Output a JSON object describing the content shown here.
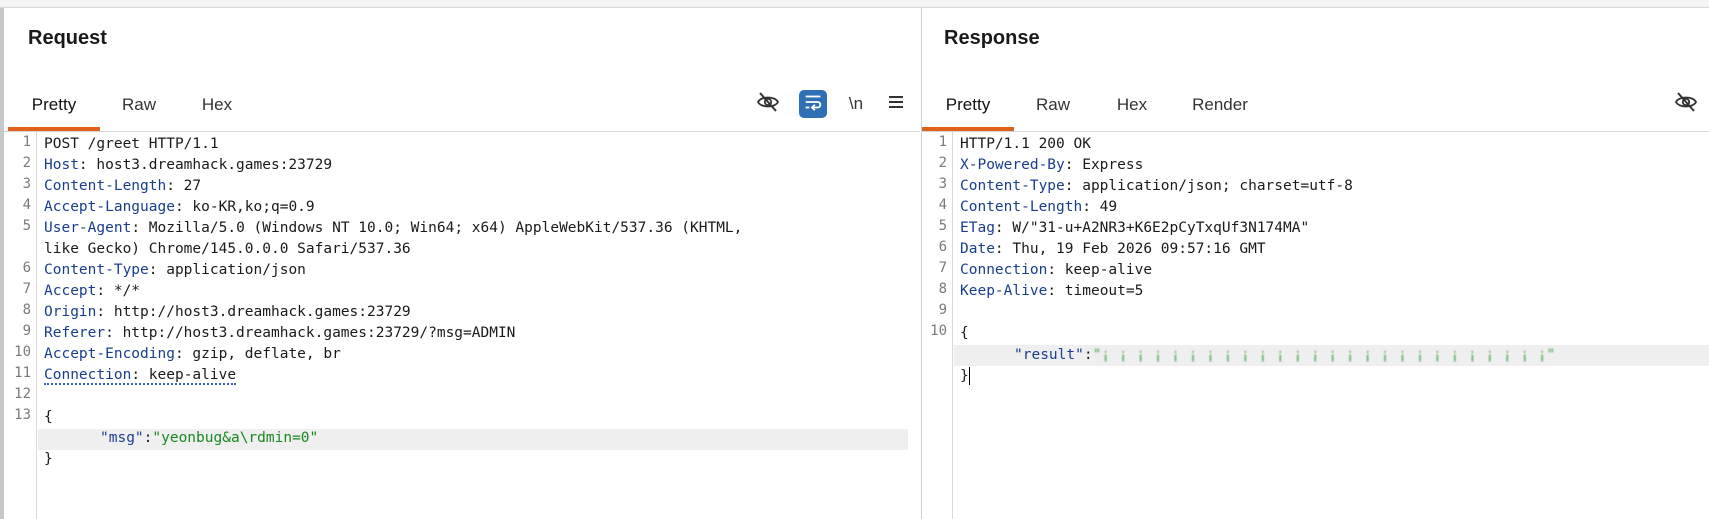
{
  "request": {
    "title": "Request",
    "tabs": [
      "Pretty",
      "Raw",
      "Hex"
    ],
    "tools": {
      "hide_icon": "eye-slash-icon",
      "wrap_icon": "wrap-icon",
      "newline_label": "\\n",
      "menu_icon": "hamburger-icon"
    },
    "line_numbers": [
      "1",
      "2",
      "3",
      "4",
      "5",
      "",
      "6",
      "7",
      "8",
      "9",
      "10",
      "11",
      "12",
      "13"
    ],
    "lines": [
      {
        "name": "",
        "value": "POST /greet HTTP/1.1"
      },
      {
        "name": "Host",
        "value": ": host3.dreamhack.games:23729"
      },
      {
        "name": "Content-Length",
        "value": ": 27"
      },
      {
        "name": "Accept-Language",
        "value": ": ko-KR,ko;q=0.9"
      },
      {
        "name": "User-Agent",
        "value": ": Mozilla/5.0 (Windows NT 10.0; Win64; x64) AppleWebKit/537.36 (KHTML,"
      },
      {
        "name": "",
        "value": "like Gecko) Chrome/145.0.0.0 Safari/537.36"
      },
      {
        "name": "Content-Type",
        "value": ": application/json"
      },
      {
        "name": "Accept",
        "value": ": */*"
      },
      {
        "name": "Origin",
        "value": ": http://host3.dreamhack.games:23729"
      },
      {
        "name": "Referer",
        "value": ": http://host3.dreamhack.games:23729/?msg=ADMIN"
      },
      {
        "name": "Accept-Encoding",
        "value": ": gzip, deflate, br"
      },
      {
        "name": "Connection",
        "value": ": keep-alive"
      },
      {
        "name": "",
        "value": ""
      },
      {
        "name": "",
        "value": "{"
      }
    ],
    "body": {
      "key": "\"msg\"",
      "colon": ":",
      "value": "\"yeonbug&a\\rdmin=0\"",
      "close": "}"
    }
  },
  "response": {
    "title": "Response",
    "tabs": [
      "Pretty",
      "Raw",
      "Hex",
      "Render"
    ],
    "tools": {
      "hide_icon": "eye-slash-icon"
    },
    "line_numbers": [
      "1",
      "2",
      "3",
      "4",
      "5",
      "6",
      "7",
      "8",
      "9",
      "10"
    ],
    "lines": [
      {
        "name": "",
        "value": "HTTP/1.1 200 OK"
      },
      {
        "name": "X-Powered-By",
        "value": ": Express"
      },
      {
        "name": "Content-Type",
        "value": ": application/json; charset=utf-8"
      },
      {
        "name": "Content-Length",
        "value": ": 49"
      },
      {
        "name": "ETag",
        "value": ": W/\"31-u+A2NR3+K6E2pCyTxqUf3N174MA\""
      },
      {
        "name": "Date",
        "value": ": Thu, 19 Feb 2026 09:57:16 GMT"
      },
      {
        "name": "Connection",
        "value": ": keep-alive"
      },
      {
        "name": "Keep-Alive",
        "value": ": timeout=5"
      },
      {
        "name": "",
        "value": ""
      },
      {
        "name": "",
        "value": "{"
      }
    ],
    "body": {
      "key": "\"result\"",
      "colon": ":",
      "value": "\"¡ ¡ ¡ ¡ ¡ ¡ ¡ ¡ ¡ ¡ ¡ ¡ ¡ ¡ ¡ ¡ ¡ ¡ ¡ ¡ ¡ ¡ ¡ ¡ ¡ ¡\"",
      "close": "}"
    }
  },
  "colors": {
    "accent": "#e0621a",
    "header_name": "#1a3d8f",
    "string": "#178a20",
    "wrap_active": "#2f6fb3"
  }
}
